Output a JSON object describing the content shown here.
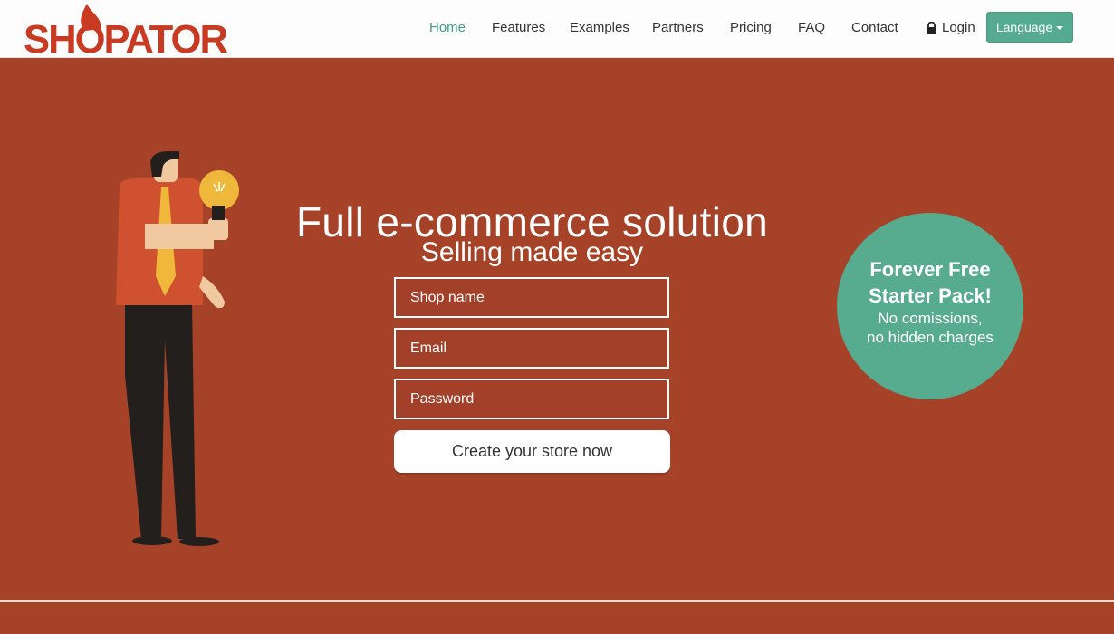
{
  "brand": {
    "logo_text": "SHOPATOR",
    "primary_color": "#c83a22",
    "accent_color": "#55ab8f",
    "hero_bg": "#a64228"
  },
  "nav": {
    "items": [
      {
        "label": "Home",
        "active": true
      },
      {
        "label": "Features"
      },
      {
        "label": "Examples"
      },
      {
        "label": "Partners"
      },
      {
        "label": "Pricing"
      },
      {
        "label": "FAQ"
      },
      {
        "label": "Contact"
      }
    ],
    "login_label": "Login",
    "language_label": "Language"
  },
  "hero": {
    "title": "Full e-commerce solution",
    "subtitle": "Selling made easy",
    "shop_placeholder": "Shop name",
    "email_placeholder": "Email",
    "password_placeholder": "Password",
    "cta_label": "Create your store now"
  },
  "badge": {
    "line1": "Forever Free",
    "line2": "Starter Pack!",
    "line3": "No comissions,",
    "line4": "no hidden charges"
  },
  "icons": {
    "login": "lock-icon",
    "language": "caret-down-icon",
    "illustration": "man-with-lightbulb"
  }
}
